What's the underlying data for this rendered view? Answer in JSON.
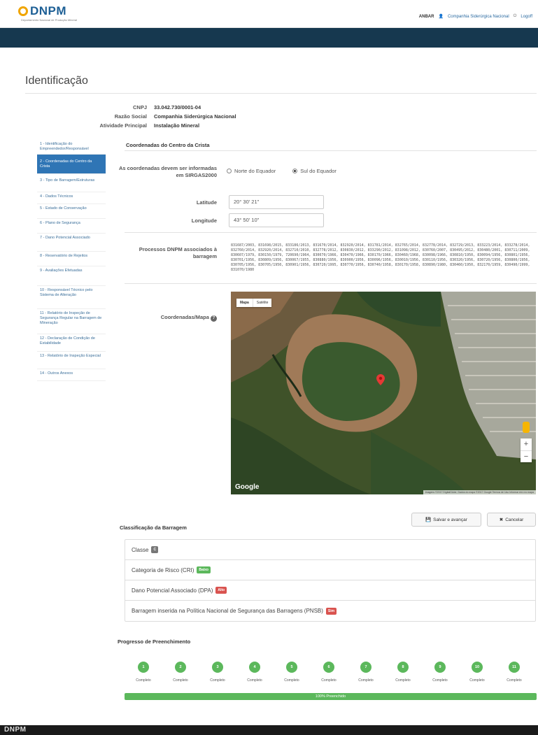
{
  "header": {
    "logo_text": "DNPM",
    "logo_sub": "Departamento Nacional de Produção Mineral",
    "user_id": "ANBAR",
    "company_link": "Companhia Siderúrgica Nacional",
    "logout": "Logoff"
  },
  "page": {
    "title": "Identificação"
  },
  "ident": {
    "cnpj_label": "CNPJ",
    "cnpj": "33.042.730/0001-04",
    "razao_label": "Razão Social",
    "razao": "Companhia Siderúrgica Nacional",
    "atividade_label": "Atividade Principal",
    "atividade": "Instalação Mineral"
  },
  "sidebar": {
    "items": [
      {
        "label": "1 - Identificação do Empreendedor/Responsável"
      },
      {
        "label": "2 - Coordenadas do Centro da Crista"
      },
      {
        "label": "3 - Tipo de Barragem/Estruturas"
      },
      {
        "label": "4 - Dados Técnicos"
      },
      {
        "label": "5 - Estado de Conservação"
      },
      {
        "label": "6 - Plano de Segurança"
      },
      {
        "label": "7 - Dano Potencial Associado"
      },
      {
        "label": "8 - Reservatório de Rejeitos"
      },
      {
        "label": "9 - Avaliações Efetuadas"
      },
      {
        "label": "10 - Responsável Técnico pelo Sistema de Alteração"
      },
      {
        "label": "11 - Relatório de Inspeção de Segurança Regular na Barragem de Mineração"
      },
      {
        "label": "12 - Declaração de Condição de Estabilidade"
      },
      {
        "label": "13 - Relatório de Inspeção Especial"
      },
      {
        "label": "14 - Outros Anexos"
      }
    ]
  },
  "coords": {
    "section_title": "Coordenadas do Centro da Crista",
    "hemisphere_label": "As coordenadas devem ser informadas em SIRGAS2000",
    "opt_north": "Norte do Equador",
    "opt_south": "Sul do Equador",
    "lat_label": "Latitude",
    "lat_value": "20° 30' 21\"",
    "lon_label": "Longitude",
    "lon_value": "43° 50' 10\"",
    "processos_label": "Processos DNPM associados à barragem",
    "processos_value": "831687/2003, 831698/2015, 833186/2013, 831670/2014, 832920/2014, 831781/2014, 832765/2014, 832778/2014, 832729/2013, 833223/2014, 833278/2014, 832760/2014, 832920/2014, 832710/2010, 832778/2012, 830830/2012, 833290/2012, 831098/2012, 830760/2007, 830495/2012, 830480/2001, 830711/2009, 830607/1979, 830150/1979, 720690/1964, 830070/1966, 830470/1966, 830170/1966, 830460/1968, 830098/1966, 830810/1950, 830094/1956, 830801/1956, 830701/1956, 830809/1956, 830067/1955, 830880/1956, 830900/1956, 830096/1956, 830010/1956, 830110/1956, 830320/1956, 830720/1956, 830800/1956, 830705/1956, 830705/1950, 830901/1956, 830720/1995, 830770/1956, 830740/1958, 830170/1958, 830890/1980, 830460/1950, 832170/1959, 830490/1999, 831070/1980"
  },
  "map": {
    "label": "Coordenadas/Mapa",
    "btn_map": "Mapa",
    "btn_sat": "Satélite",
    "google": "Google",
    "attribution": "Imagens ©2017 DigitalGlobe, Dados do mapa ©2017 Google   Termos de Uso   Informar erro no mapa",
    "zoom_in": "+",
    "zoom_out": "−"
  },
  "actions": {
    "save": "Salvar e avançar",
    "cancel": "Cancelar"
  },
  "classification": {
    "title": "Classificação da Barragem",
    "classe_label": "Classe",
    "classe_value": "C",
    "cri_label": "Categoria de Risco (CRI)",
    "cri_value": "Baixo",
    "dpa_label": "Dano Potencial Associado (DPA)",
    "dpa_value": "Alto",
    "pnsb_label": "Barragem inserida na Política Nacional de Segurança das Barragens (PNSB)",
    "pnsb_value": "Sim"
  },
  "progress": {
    "title": "Progresso de Preenchimento",
    "steps": [
      {
        "num": "1",
        "status": "Completo"
      },
      {
        "num": "2",
        "status": "Completo"
      },
      {
        "num": "3",
        "status": "Completo"
      },
      {
        "num": "4",
        "status": "Completo"
      },
      {
        "num": "5",
        "status": "Completo"
      },
      {
        "num": "6",
        "status": "Completo"
      },
      {
        "num": "7",
        "status": "Completo"
      },
      {
        "num": "8",
        "status": "Completo"
      },
      {
        "num": "9",
        "status": "Completo"
      },
      {
        "num": "10",
        "status": "Completo"
      },
      {
        "num": "11",
        "status": "Completo"
      }
    ],
    "percent": 100,
    "bar_text": "100% Preenchido"
  },
  "footer": {
    "logo_text": "DNPM"
  },
  "colors": {
    "nav": "#16384f",
    "active": "#2f75b5",
    "success": "#5cb85c",
    "danger": "#d9534f"
  }
}
